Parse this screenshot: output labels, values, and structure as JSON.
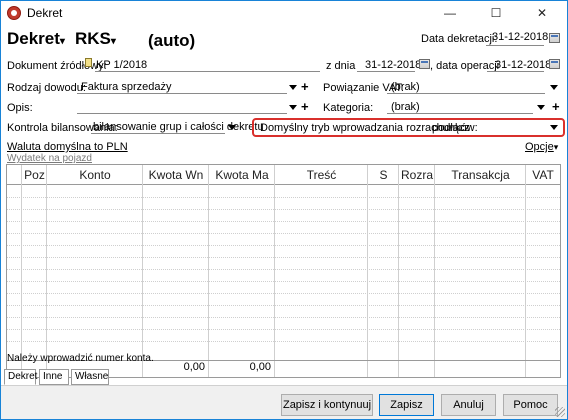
{
  "window": {
    "title": "Dekret",
    "minimize": "—",
    "maximize": "☐",
    "close": "✕"
  },
  "header": {
    "doc_type": "Dekret",
    "register": "RKS",
    "number": "(auto)",
    "decree_date_label": "Data dekretacji:",
    "decree_date": "31-12-2018"
  },
  "form": {
    "source_doc_label": "Dokument źródłowy:",
    "source_doc_value": "KP 1/2018",
    "date_label": "z dnia",
    "date_value": "31-12-2018",
    "operation_date_label": ", data operacji",
    "operation_date_value": "31-12-2018",
    "proof_type_label": "Rodzaj dowodu:",
    "proof_type_value": "Faktura sprzedaży",
    "vat_link_label": "Powiązanie VAT:",
    "vat_link_value": "(brak)",
    "description_label": "Opis:",
    "description_value": "",
    "category_label": "Kategoria:",
    "category_value": "(brak)",
    "balance_control_label": "Kontrola bilansowania:",
    "balance_control_value": "bilansowanie grup i całości dekretu",
    "settlement_mode_label": "Domyślny tryb wprowadzania rozrachunków:",
    "settlement_mode_value": "podłącz"
  },
  "links": {
    "currency": "Waluta domyślna to PLN",
    "vehicle_expense": "Wydatek na pojazd",
    "options": "Opcje"
  },
  "table": {
    "columns": [
      "Poz",
      "Konto",
      "Kwota Wn",
      "Kwota Ma",
      "Treść",
      "S",
      "Rozra",
      "Transakcja",
      "VAT"
    ],
    "sum_wn": "0,00",
    "sum_ma": "0,00"
  },
  "status_message": "Należy wprowadzić numer konta.",
  "tabs": [
    "Dekret",
    "Inne",
    "Własne"
  ],
  "buttons": {
    "save_continue": "Zapisz i kontynuuj",
    "save": "Zapisz",
    "cancel": "Anuluj",
    "help": "Pomoc"
  },
  "colors": {
    "highlight": "#d9302c",
    "accent": "#0078d7"
  }
}
